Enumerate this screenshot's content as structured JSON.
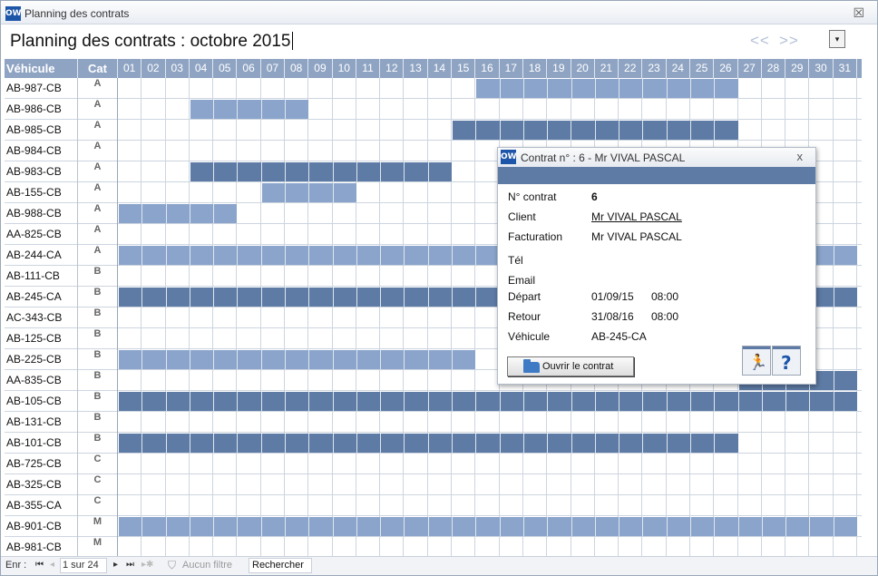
{
  "window": {
    "title": "Planning des contrats",
    "icon_label": "OW",
    "close_glyph": "☒"
  },
  "header": {
    "title": "Planning des contrats : octobre 2015",
    "prev_label": "<<",
    "next_label": ">>",
    "dropdown_glyph": "▾"
  },
  "grid": {
    "vehicle_header": "Véhicule",
    "cat_header": "Cat",
    "days": [
      "01",
      "02",
      "03",
      "04",
      "05",
      "06",
      "07",
      "08",
      "09",
      "10",
      "11",
      "12",
      "13",
      "14",
      "15",
      "16",
      "17",
      "18",
      "19",
      "20",
      "21",
      "22",
      "23",
      "24",
      "25",
      "26",
      "27",
      "28",
      "29",
      "30",
      "31"
    ],
    "rows": [
      {
        "vehicle": "AB-987-CB",
        "cat": "A",
        "bars": [
          {
            "from": 16,
            "to": 26,
            "shade": "light"
          }
        ]
      },
      {
        "vehicle": "AB-986-CB",
        "cat": "A",
        "bars": [
          {
            "from": 4,
            "to": 8,
            "shade": "light"
          }
        ]
      },
      {
        "vehicle": "AB-985-CB",
        "cat": "A",
        "bars": [
          {
            "from": 15,
            "to": 26,
            "shade": "dark"
          }
        ]
      },
      {
        "vehicle": "AB-984-CB",
        "cat": "A",
        "bars": []
      },
      {
        "vehicle": "AB-983-CB",
        "cat": "A",
        "bars": [
          {
            "from": 4,
            "to": 14,
            "shade": "dark"
          }
        ]
      },
      {
        "vehicle": "AB-155-CB",
        "cat": "A",
        "bars": [
          {
            "from": 7,
            "to": 10,
            "shade": "light"
          }
        ]
      },
      {
        "vehicle": "AB-988-CB",
        "cat": "A",
        "bars": [
          {
            "from": 1,
            "to": 5,
            "shade": "light"
          }
        ]
      },
      {
        "vehicle": "AA-825-CB",
        "cat": "A",
        "bars": []
      },
      {
        "vehicle": "AB-244-CA",
        "cat": "A",
        "bars": [
          {
            "from": 1,
            "to": 31,
            "shade": "light"
          }
        ]
      },
      {
        "vehicle": "AB-111-CB",
        "cat": "B",
        "bars": []
      },
      {
        "vehicle": "AB-245-CA",
        "cat": "B",
        "bars": [
          {
            "from": 1,
            "to": 31,
            "shade": "dark"
          }
        ]
      },
      {
        "vehicle": "AC-343-CB",
        "cat": "B",
        "bars": []
      },
      {
        "vehicle": "AB-125-CB",
        "cat": "B",
        "bars": []
      },
      {
        "vehicle": "AB-225-CB",
        "cat": "B",
        "bars": [
          {
            "from": 1,
            "to": 15,
            "shade": "light"
          }
        ]
      },
      {
        "vehicle": "AA-835-CB",
        "cat": "B",
        "bars": [
          {
            "from": 27,
            "to": 31,
            "shade": "dark"
          }
        ]
      },
      {
        "vehicle": "AB-105-CB",
        "cat": "B",
        "bars": [
          {
            "from": 1,
            "to": 31,
            "shade": "dark"
          }
        ]
      },
      {
        "vehicle": "AB-131-CB",
        "cat": "B",
        "bars": []
      },
      {
        "vehicle": "AB-101-CB",
        "cat": "B",
        "bars": [
          {
            "from": 1,
            "to": 26,
            "shade": "dark"
          }
        ]
      },
      {
        "vehicle": "AB-725-CB",
        "cat": "C",
        "bars": []
      },
      {
        "vehicle": "AB-325-CB",
        "cat": "C",
        "bars": []
      },
      {
        "vehicle": "AB-355-CA",
        "cat": "C",
        "bars": []
      },
      {
        "vehicle": "AB-901-CB",
        "cat": "M",
        "bars": [
          {
            "from": 1,
            "to": 31,
            "shade": "light"
          }
        ]
      },
      {
        "vehicle": "AB-981-CB",
        "cat": "M",
        "bars": []
      }
    ]
  },
  "popup": {
    "title": "Contrat n° : 6 - Mr VIVAL PASCAL",
    "close_glyph": "x",
    "contract_no_label": "N° contrat",
    "contract_no": "6",
    "client_label": "Client",
    "client": "Mr VIVAL PASCAL",
    "billing_label": "Facturation",
    "billing": "Mr VIVAL PASCAL",
    "phone_label": "Tél",
    "email_label": "Email",
    "departure_label": "Départ",
    "departure_date": "01/09/15",
    "departure_time": "08:00",
    "return_label": "Retour",
    "return_date": "31/08/16",
    "return_time": "08:00",
    "vehicle_label": "Véhicule",
    "vehicle": "AB-245-CA",
    "open_button": "Ouvrir le contrat",
    "exit_glyph": "🏃",
    "help_glyph": "?"
  },
  "statusbar": {
    "record_label": "Enr :",
    "first_glyph": "⏮",
    "prev_glyph": "◂",
    "next_glyph": "▸",
    "last_glyph": "⏭",
    "new_glyph": "▸✱",
    "position": "1 sur 24",
    "filter_glyph": "⛉",
    "filter_label": "Aucun filtre",
    "search_label": "Rechercher"
  },
  "colors": {
    "header_bg": "#8fa4c3",
    "bar_light": "#8aa4cb",
    "bar_dark": "#5d7ba5",
    "accent": "#1d55a8"
  }
}
